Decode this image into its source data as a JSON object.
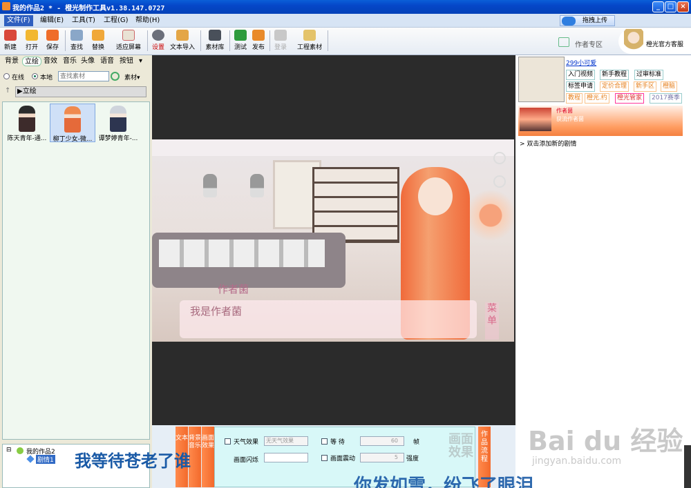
{
  "window": {
    "title": "我的作品2 * - 橙光制作工具v1.38.147.0727"
  },
  "menu": [
    {
      "label": "文件(F)"
    },
    {
      "label": "编辑(E)"
    },
    {
      "label": "工具(T)"
    },
    {
      "label": "工程(G)"
    },
    {
      "label": "帮助(H)"
    }
  ],
  "upload_label": "拖拽上传",
  "toolbar": [
    {
      "label": "新建",
      "icon": "new-file-icon"
    },
    {
      "label": "打开",
      "icon": "folder-open-icon"
    },
    {
      "label": "保存",
      "icon": "save-icon"
    },
    {
      "label": "查找",
      "icon": "find-icon"
    },
    {
      "label": "替换",
      "icon": "replace-icon"
    },
    {
      "label": "适应屏幕",
      "icon": "fit-screen-icon"
    },
    {
      "label": "设置",
      "icon": "settings-icon"
    },
    {
      "label": "文本导入",
      "icon": "text-import-icon"
    },
    {
      "label": "素材库",
      "icon": "asset-library-icon"
    },
    {
      "label": "测试",
      "icon": "test-run-icon"
    },
    {
      "label": "发布",
      "icon": "publish-icon"
    },
    {
      "label": "登录",
      "icon": "login-icon"
    },
    {
      "label": "工程素材",
      "icon": "project-assets-icon"
    }
  ],
  "author_zone": "作者专区",
  "service": "橙光官方客服",
  "left": {
    "categories": [
      "背景",
      "立绘",
      "音效",
      "音乐",
      "头像",
      "语音",
      "按钮"
    ],
    "source_online": "在线",
    "source_local": "本地",
    "search_placeholder": "查找素材",
    "material_menu": "素材",
    "folder": "▶立绘",
    "assets": [
      {
        "name": "陈天青年-通..."
      },
      {
        "name": "柳丁少女-微..."
      },
      {
        "name": "谭梦婷青年-..."
      }
    ],
    "tree": {
      "root": "我的作品2",
      "child": "剧情1"
    }
  },
  "scene": {
    "name": "作者菌",
    "line": "我是作者菌",
    "menu": "菜单"
  },
  "bottom": {
    "tabs": [
      "文本",
      "背景音乐",
      "画面效果"
    ],
    "weather_label": "天气效果",
    "weather_value": "无天气效果",
    "flash_label": "画面闪烁",
    "wait_label": "等  待",
    "wait_value": "60",
    "wait_unit": "帧",
    "shake_label": "画面震动",
    "shake_value": "5",
    "shake_unit": "强度",
    "section_title": "画面效果",
    "flow_tab": "作品流程"
  },
  "right": {
    "user_name": "299小可爱",
    "links": [
      "入门视频",
      "新手教程",
      "过审标准",
      "标签申请",
      "定价合理",
      "新手区",
      "橙脑",
      "教程",
      "橙光.约",
      "橙光管家",
      "2017赛季"
    ],
    "feature_title": "作者菌",
    "feature_sub": "获流作者菌",
    "add_story": "双击添加新的剧情"
  },
  "overlay": {
    "title": "我等待苍老了谁",
    "lyric": "你发如雪，纷飞了眼泪"
  },
  "watermark": {
    "big": "Bai du 经验",
    "small": "jingyan.baidu.com"
  }
}
